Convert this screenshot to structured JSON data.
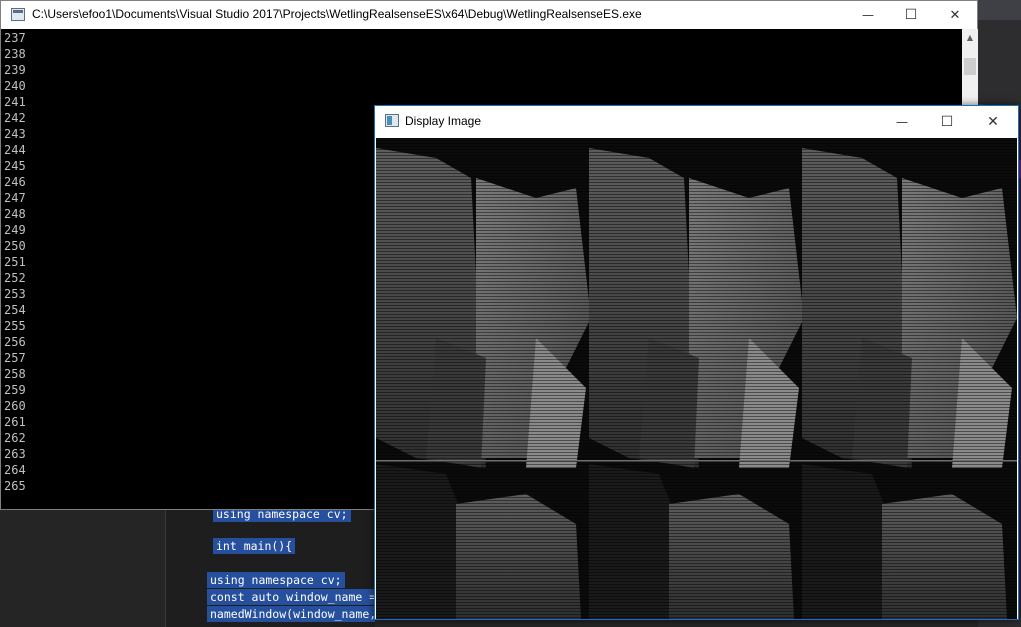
{
  "ide": {
    "code_lines": [
      "using namespace cv;",
      "int main(){",
      "using namespace cv;",
      "const auto window_name =",
      "namedWindow(window_name,"
    ]
  },
  "console": {
    "title": "C:\\Users\\efoo1\\Documents\\Visual Studio 2017\\Projects\\WetlingRealsenseES\\x64\\Debug\\WetlingRealsenseES.exe",
    "lines": [
      "237",
      "238",
      "239",
      "240",
      "241",
      "242",
      "243",
      "244",
      "245",
      "246",
      "247",
      "248",
      "249",
      "250",
      "251",
      "252",
      "253",
      "254",
      "255",
      "256",
      "257",
      "258",
      "259",
      "260",
      "261",
      "262",
      "263",
      "264",
      "265"
    ],
    "minimize_glyph": "—",
    "maximize_glyph": "☐",
    "close_glyph": "✕"
  },
  "display_window": {
    "title": "Display Image",
    "minimize_glyph": "—",
    "maximize_glyph": "☐",
    "close_glyph": "✕"
  },
  "colors": {
    "console_bg": "#000000",
    "console_text": "#c0c0c0",
    "selection": "#264f9e",
    "active_border": "#1b6fbf"
  },
  "icons": {
    "console_app": "console-app-icon",
    "display_app": "opencv-window-icon",
    "scroll_up": "chevron-up-icon",
    "scroll_down": "chevron-down-icon"
  }
}
